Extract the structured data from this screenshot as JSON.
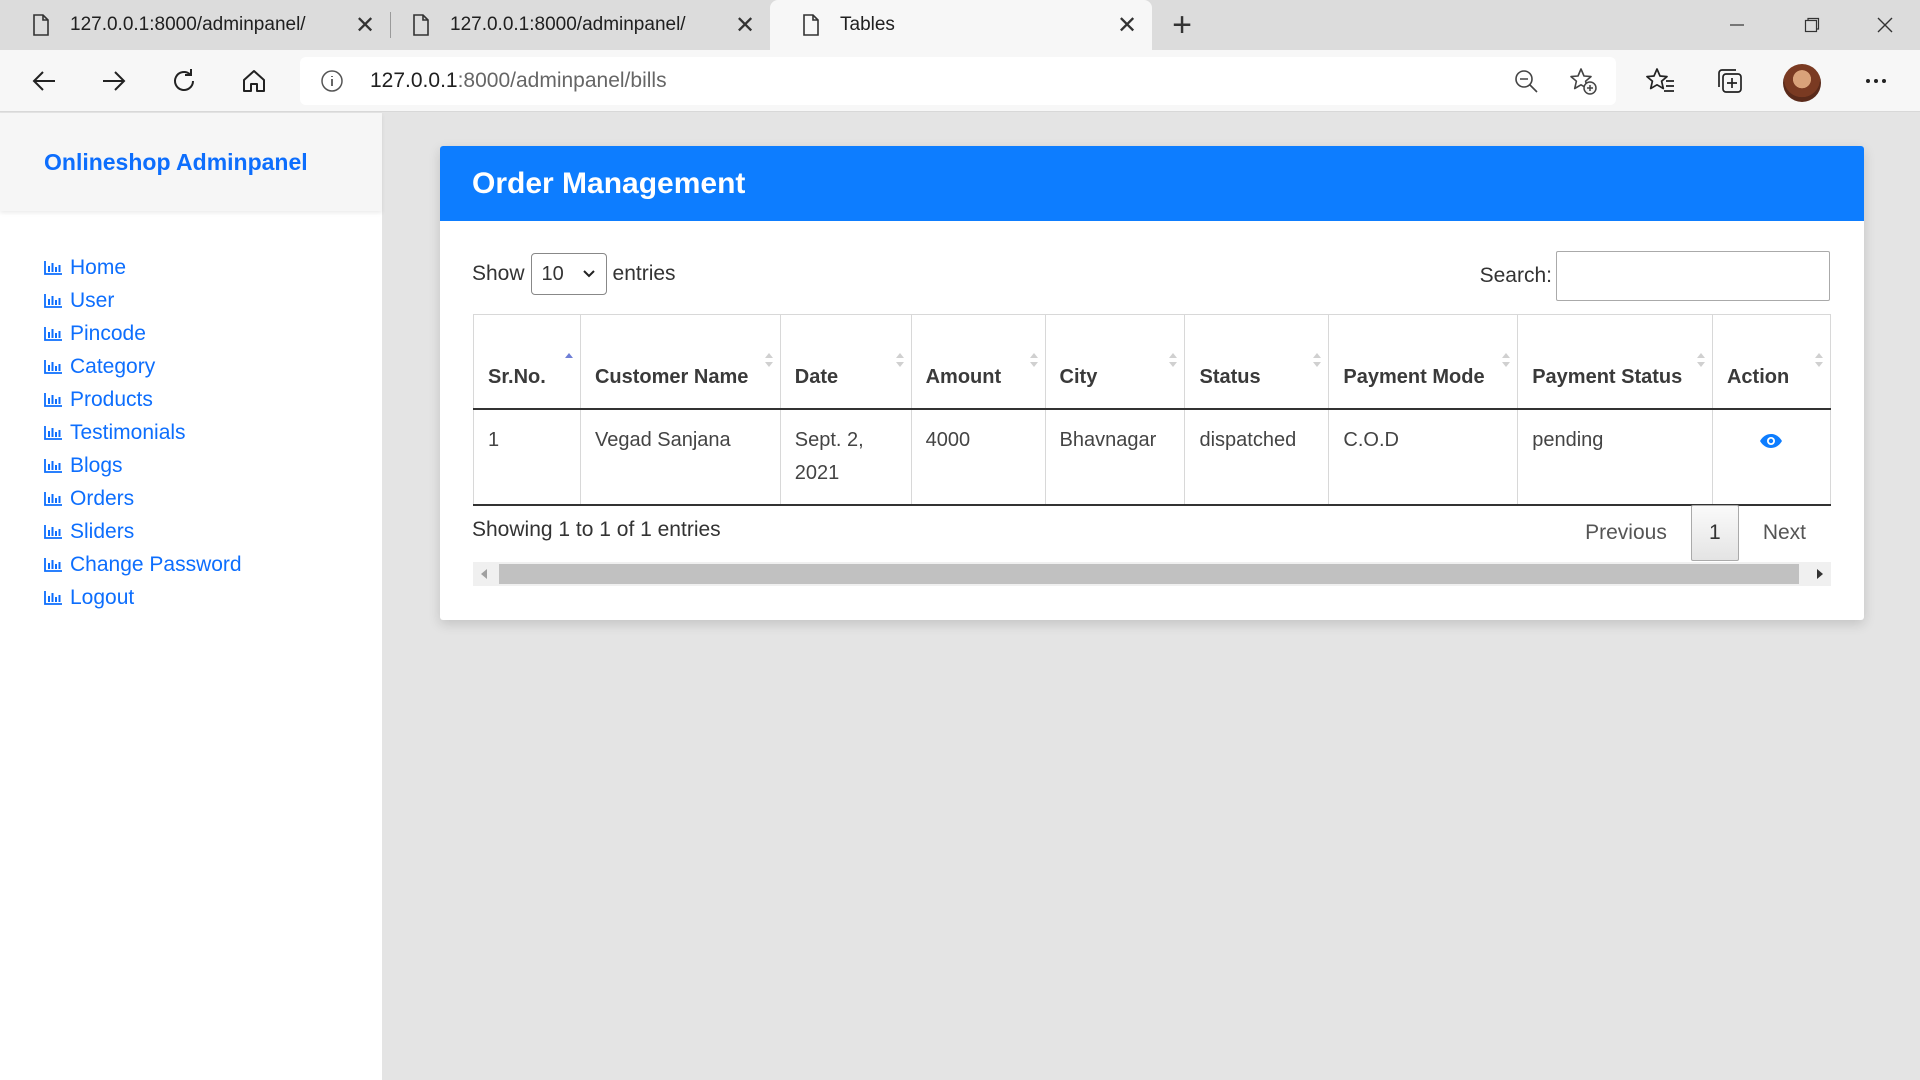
{
  "browser": {
    "tabs": [
      {
        "title": "127.0.0.1:8000/adminpanel/",
        "active": false
      },
      {
        "title": "127.0.0.1:8000/adminpanel/",
        "active": false
      },
      {
        "title": "Tables",
        "active": true
      }
    ],
    "url_host": "127.0.0.1",
    "url_rest": ":8000/adminpanel/bills"
  },
  "sidebar": {
    "brand": "Onlineshop Adminpanel",
    "items": [
      {
        "label": "Home"
      },
      {
        "label": "User"
      },
      {
        "label": "Pincode"
      },
      {
        "label": "Category"
      },
      {
        "label": "Products"
      },
      {
        "label": "Testimonials"
      },
      {
        "label": "Blogs"
      },
      {
        "label": "Orders"
      },
      {
        "label": "Sliders"
      },
      {
        "label": "Change Password"
      },
      {
        "label": "Logout"
      }
    ]
  },
  "main": {
    "title": "Order Management",
    "length_label_before": "Show",
    "length_value": "10",
    "length_label_after": "entries",
    "search_label": "Search:",
    "search_value": "",
    "columns": [
      "Sr.No.",
      "Customer Name",
      "Date",
      "Amount",
      "City",
      "Status",
      "Payment Mode",
      "Payment Status",
      "Action"
    ],
    "rows": [
      {
        "sr_no": "1",
        "customer_name": "Vegad Sanjana",
        "date": "Sept. 2, 2021",
        "amount": "4000",
        "city": "Bhavnagar",
        "status": "dispatched",
        "payment_mode": "C.O.D",
        "payment_status": "pending"
      }
    ],
    "info": "Showing 1 to 1 of 1 entries",
    "pager": {
      "previous": "Previous",
      "current": "1",
      "next": "Next"
    }
  },
  "colors": {
    "accent": "#0d7dff",
    "link": "#0d6efd"
  }
}
